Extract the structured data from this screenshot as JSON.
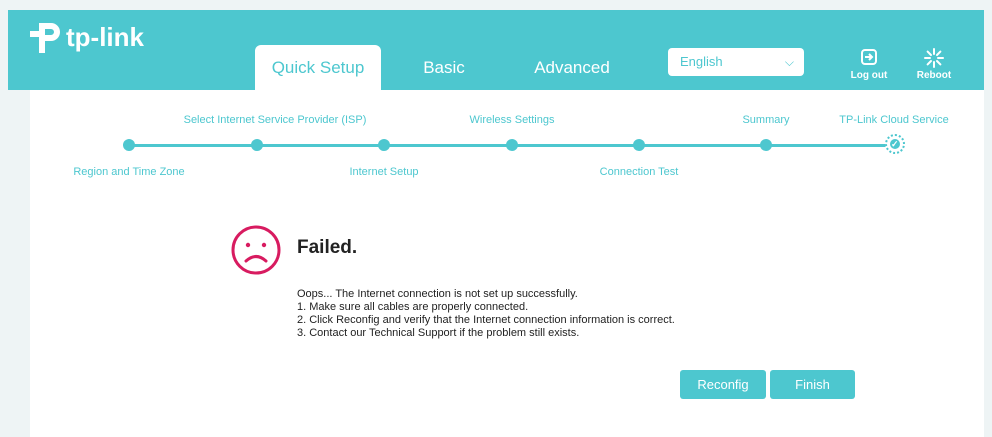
{
  "brand": {
    "name": "tp-link"
  },
  "tabs": [
    {
      "label": "Quick Setup",
      "active": true
    },
    {
      "label": "Basic",
      "active": false
    },
    {
      "label": "Advanced",
      "active": false
    }
  ],
  "language": {
    "selected": "English"
  },
  "header_buttons": {
    "logout": "Log out",
    "reboot": "Reboot"
  },
  "steps": {
    "labels": [
      "Region and Time Zone",
      "Select Internet Service Provider (ISP)",
      "Internet Setup",
      "Wireless Settings",
      "Connection Test",
      "Summary",
      "TP-Link Cloud Service"
    ],
    "current": "TP-Link Cloud Service"
  },
  "result": {
    "title": "Failed.",
    "lines": [
      "Oops... The Internet connection is not set up successfully.",
      "1. Make sure all cables are properly connected.",
      "2. Click Reconfig and verify that the Internet connection information is correct.",
      "3. Contact our Technical Support if the problem still exists."
    ]
  },
  "buttons": {
    "reconfig": "Reconfig",
    "finish": "Finish"
  },
  "colors": {
    "accent": "#4dc7cf",
    "error": "#d81b60"
  }
}
